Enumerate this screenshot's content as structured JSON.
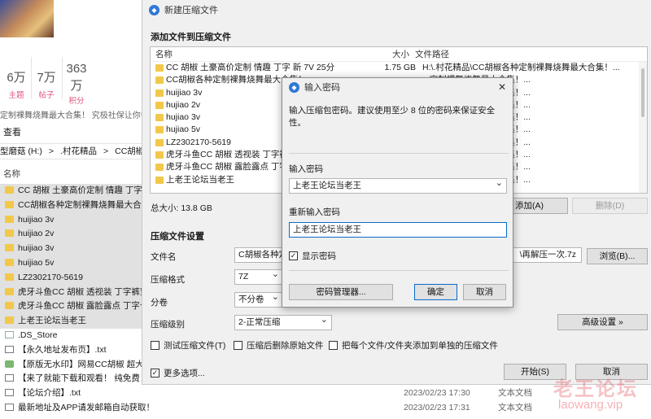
{
  "background": {
    "stats": [
      {
        "num": "6万",
        "label": "主题"
      },
      {
        "num": "7万",
        "label": "帖子"
      },
      {
        "num": "363万",
        "label": "积分"
      }
    ],
    "note": "定制裸舞烧舞最大合集！ 究极社保让你中",
    "view_tab": "查看",
    "address": [
      "型磨菇 (H:)",
      ">",
      ".村花精品",
      ">",
      "CC胡椒各种"
    ],
    "name_header": "名称",
    "files": [
      {
        "name": "CC 胡椒 土豪高价定制 情趣 丁字 新",
        "icon": "folder-icon",
        "date": "",
        "type": "",
        "selected": true
      },
      {
        "name": "CC胡椒各种定制裸舞烧舞最大合集！",
        "icon": "folder-icon",
        "date": "",
        "type": "",
        "selected": true
      },
      {
        "name": "huijiao 3v",
        "icon": "folder-icon",
        "date": "",
        "type": "",
        "selected": true
      },
      {
        "name": "huijiao 2v",
        "icon": "folder-icon",
        "date": "",
        "type": "",
        "selected": true
      },
      {
        "name": "huijiao 3v",
        "icon": "folder-icon",
        "date": "",
        "type": "",
        "selected": true
      },
      {
        "name": "huijiao 5v",
        "icon": "folder-icon",
        "date": "",
        "type": "",
        "selected": true
      },
      {
        "name": "LZ2302170-5619",
        "icon": "folder-icon",
        "date": "",
        "type": "",
        "selected": true
      },
      {
        "name": "虎牙斗鱼CC 胡椒 透视装 丁字裤穿查",
        "icon": "folder-icon",
        "date": "",
        "type": "",
        "selected": true
      },
      {
        "name": "虎牙斗鱼CC 胡椒 露脸露点 丁字卡进",
        "icon": "folder-icon",
        "date": "",
        "type": "",
        "selected": true
      },
      {
        "name": "上老王论坛当老王",
        "icon": "folder-icon",
        "date": "",
        "type": "",
        "selected": true
      },
      {
        "name": ".DS_Store",
        "icon": "file-icon",
        "date": "",
        "type": "",
        "selected": false
      },
      {
        "name": "【永久地址发布页】.txt",
        "icon": "txt-file-icon",
        "date": "",
        "type": "",
        "selected": false
      },
      {
        "name": "【原版无水印】网易CC胡椒 超大尺度",
        "icon": "image-file-icon",
        "date": "",
        "type": "",
        "selected": false
      },
      {
        "name": "【来了就能下载和观看！ 纯免费！ 】",
        "icon": "txt-file-icon",
        "date": "",
        "type": "",
        "selected": false
      },
      {
        "name": "【论坛介绍】.txt",
        "icon": "txt-file-icon",
        "date": "2023/02/23 17:30",
        "type": "文本文档",
        "selected": false
      },
      {
        "name": "最新地址及APP请发邮箱自动获取！！！.txt",
        "icon": "txt-file-icon",
        "date": "2023/02/23 17:31",
        "type": "文本文档",
        "selected": false
      }
    ]
  },
  "archive": {
    "title": "新建压缩文件",
    "section_add": "添加文件到压缩文件",
    "columns": {
      "name": "名称",
      "size": "大小",
      "path": "文件路径"
    },
    "items": [
      {
        "name": "CC 胡椒 土豪高价定制 情趣 丁字 新 7V 25分",
        "size": "1.75 GB",
        "path": "H:\\.村花精品\\CC胡椒各种定制裸舞烧舞最大合集！..."
      },
      {
        "name": "CC胡椒各种定制裸舞烧舞最大合集！",
        "size": "",
        "path": "...定制裸舞烧舞最大合集！..."
      },
      {
        "name": "huijiao 3v",
        "size": "",
        "path": "...定制裸舞烧舞最大合集！..."
      },
      {
        "name": "hujiao 2v",
        "size": "",
        "path": "...定制裸舞烧舞最大合集！..."
      },
      {
        "name": "hujiao 3v",
        "size": "",
        "path": "...定制裸舞烧舞最大合集！..."
      },
      {
        "name": "hujiao 5v",
        "size": "",
        "path": "...定制裸舞烧舞最大合集！..."
      },
      {
        "name": "LZ2302170-5619",
        "size": "",
        "path": "...定制裸舞烧舞最大合集！..."
      },
      {
        "name": "虎牙斗鱼CC 胡椒 透视装 丁字裤穿",
        "size": "",
        "path": "...定制裸舞烧舞最大合集！..."
      },
      {
        "name": "虎牙斗鱼CC 胡椒 露脸露点 丁字卡",
        "size": "",
        "path": "...定制裸舞烧舞最大合集！..."
      },
      {
        "name": "上老王论坛当老王",
        "size": "",
        "path": "...定制裸舞烧舞最大合集！..."
      }
    ],
    "total": "总大小: 13.8 GB",
    "add_btn": "添加(A)",
    "delete_btn": "删除(D)",
    "section_settings": "压缩文件设置",
    "filename_label": "文件名",
    "filename_value": "C胡椒各种定",
    "filename_suffix": "\\再解压一次.7z",
    "browse_btn": "浏览(B)...",
    "format_label": "压缩格式",
    "format_value": "7Z",
    "split_label": "分卷",
    "split_value": "不分卷",
    "level_label": "压缩级别",
    "level_value": "2-正常压缩",
    "advanced_btn": "高级设置 »",
    "opt_test": "测试压缩文件(T)",
    "opt_delete": "压缩后删除原始文件",
    "opt_separate": "把每个文件/文件夹添加到单独的压缩文件",
    "more_options": "更多选项...",
    "start_btn": "开始(S)",
    "cancel_btn": "取消"
  },
  "password_dialog": {
    "title": "输入密码",
    "message": "输入压缩包密码。建议使用至少 8 位的密码来保证安全性。",
    "pwd_label": "输入密码",
    "pwd_value": "上老王论坛当老王",
    "repeat_label": "重新输入密码",
    "repeat_value": "上老王论坛当老王",
    "show_password": "显示密码",
    "manager_btn": "密码管理器...",
    "ok_btn": "确定",
    "cancel_btn": "取消"
  },
  "watermark": {
    "text": "老王论坛",
    "url": "laowang.vip"
  }
}
